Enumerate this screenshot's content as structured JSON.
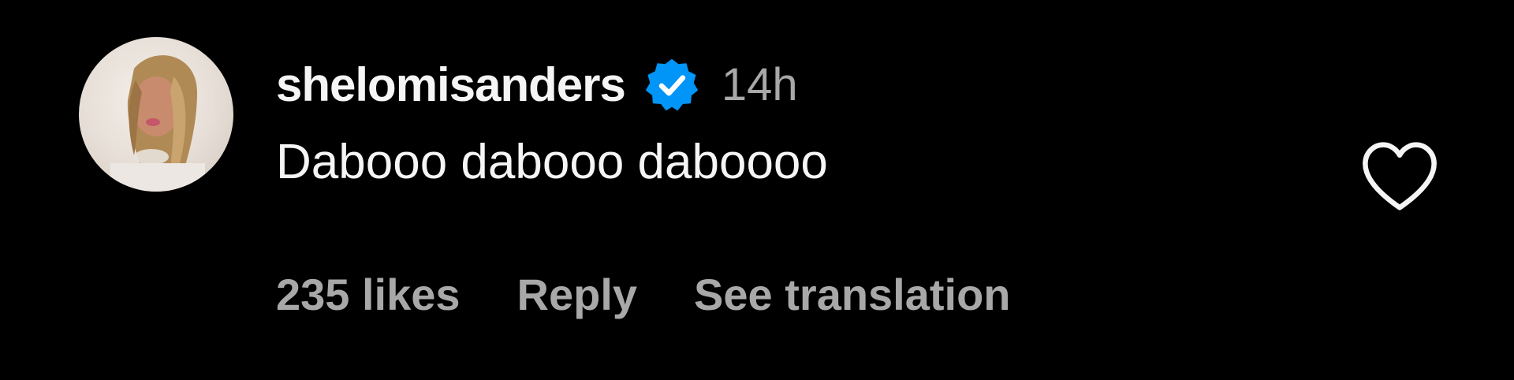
{
  "comment": {
    "username": "shelomisanders",
    "verified_icon": "verified-badge-icon",
    "time": "14h",
    "text": "Dabooo dabooo daboooo",
    "likes_label": "235 likes",
    "reply_label": "Reply",
    "translate_label": "See translation",
    "like_icon": "heart-outline-icon"
  },
  "colors": {
    "background": "#000000",
    "primary_text": "#f5f5f5",
    "secondary_text": "#a8a8a8",
    "verified_blue": "#0095f6"
  }
}
